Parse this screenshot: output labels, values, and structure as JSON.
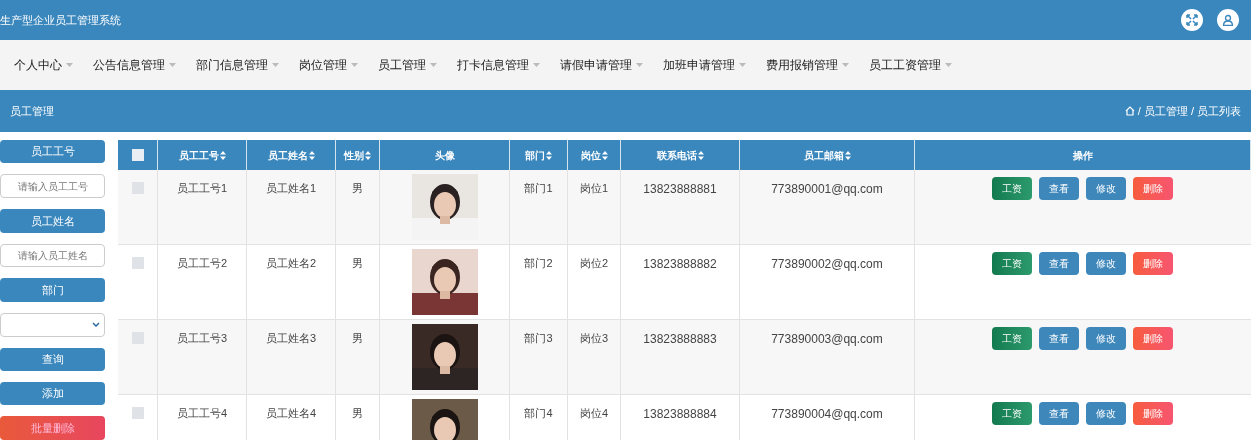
{
  "header": {
    "title": "生产型企业员工管理系统"
  },
  "nav": [
    {
      "label": "个人中心"
    },
    {
      "label": "公告信息管理"
    },
    {
      "label": "部门信息管理"
    },
    {
      "label": "岗位管理"
    },
    {
      "label": "员工管理"
    },
    {
      "label": "打卡信息管理"
    },
    {
      "label": "请假申请管理"
    },
    {
      "label": "加班申请管理"
    },
    {
      "label": "费用报销管理"
    },
    {
      "label": "员工工资管理"
    }
  ],
  "page_bar": {
    "title": "员工管理",
    "breadcrumb": [
      "/ 员工管理",
      "/ 员工列表"
    ]
  },
  "search_panel": [
    {
      "kind": "label",
      "text": "员工工号"
    },
    {
      "kind": "input",
      "placeholder": "请输入员工工号"
    },
    {
      "kind": "label",
      "text": "员工姓名"
    },
    {
      "kind": "input",
      "placeholder": "请输入员工姓名"
    },
    {
      "kind": "label",
      "text": "部门"
    },
    {
      "kind": "select"
    },
    {
      "kind": "button",
      "text": "查询"
    },
    {
      "kind": "button",
      "text": "添加"
    },
    {
      "kind": "danger-button",
      "text": "批量删除"
    }
  ],
  "table": {
    "all_checked": false,
    "columns": [
      {
        "label": "员工工号",
        "sortable": true
      },
      {
        "label": "员工姓名",
        "sortable": true
      },
      {
        "label": "性别",
        "sortable": true
      },
      {
        "label": "头像",
        "sortable": false
      },
      {
        "label": "部门",
        "sortable": true
      },
      {
        "label": "岗位",
        "sortable": true
      },
      {
        "label": "联系电话",
        "sortable": true
      },
      {
        "label": "员工邮箱",
        "sortable": true
      },
      {
        "label": "操作",
        "sortable": false
      }
    ],
    "rows": [
      {
        "checked": false,
        "id": "员工工号1",
        "name": "员工姓名1",
        "gender": "男",
        "dept": "部门1",
        "post": "岗位1",
        "phone": "13823888881",
        "email": "773890001@qq.com",
        "actions": [
          {
            "kind": "salary",
            "label": "工资"
          },
          {
            "kind": "view",
            "label": "查看"
          },
          {
            "kind": "edit",
            "label": "修改"
          },
          {
            "kind": "delete",
            "label": "删除"
          }
        ]
      },
      {
        "checked": false,
        "id": "员工工号2",
        "name": "员工姓名2",
        "gender": "男",
        "dept": "部门2",
        "post": "岗位2",
        "phone": "13823888882",
        "email": "773890002@qq.com",
        "actions": [
          {
            "kind": "salary",
            "label": "工资"
          },
          {
            "kind": "view",
            "label": "查看"
          },
          {
            "kind": "edit",
            "label": "修改"
          },
          {
            "kind": "delete",
            "label": "删除"
          }
        ]
      },
      {
        "checked": false,
        "id": "员工工号3",
        "name": "员工姓名3",
        "gender": "男",
        "dept": "部门3",
        "post": "岗位3",
        "phone": "13823888883",
        "email": "773890003@qq.com",
        "actions": [
          {
            "kind": "salary",
            "label": "工资"
          },
          {
            "kind": "view",
            "label": "查看"
          },
          {
            "kind": "edit",
            "label": "修改"
          },
          {
            "kind": "delete",
            "label": "删除"
          }
        ]
      },
      {
        "checked": false,
        "id": "员工工号4",
        "name": "员工姓名4",
        "gender": "男",
        "dept": "部门4",
        "post": "岗位4",
        "phone": "13823888884",
        "email": "773890004@qq.com",
        "actions": [
          {
            "kind": "salary",
            "label": "工资"
          },
          {
            "kind": "view",
            "label": "查看"
          },
          {
            "kind": "edit",
            "label": "修改"
          },
          {
            "kind": "delete",
            "label": "删除"
          }
        ]
      }
    ]
  }
}
